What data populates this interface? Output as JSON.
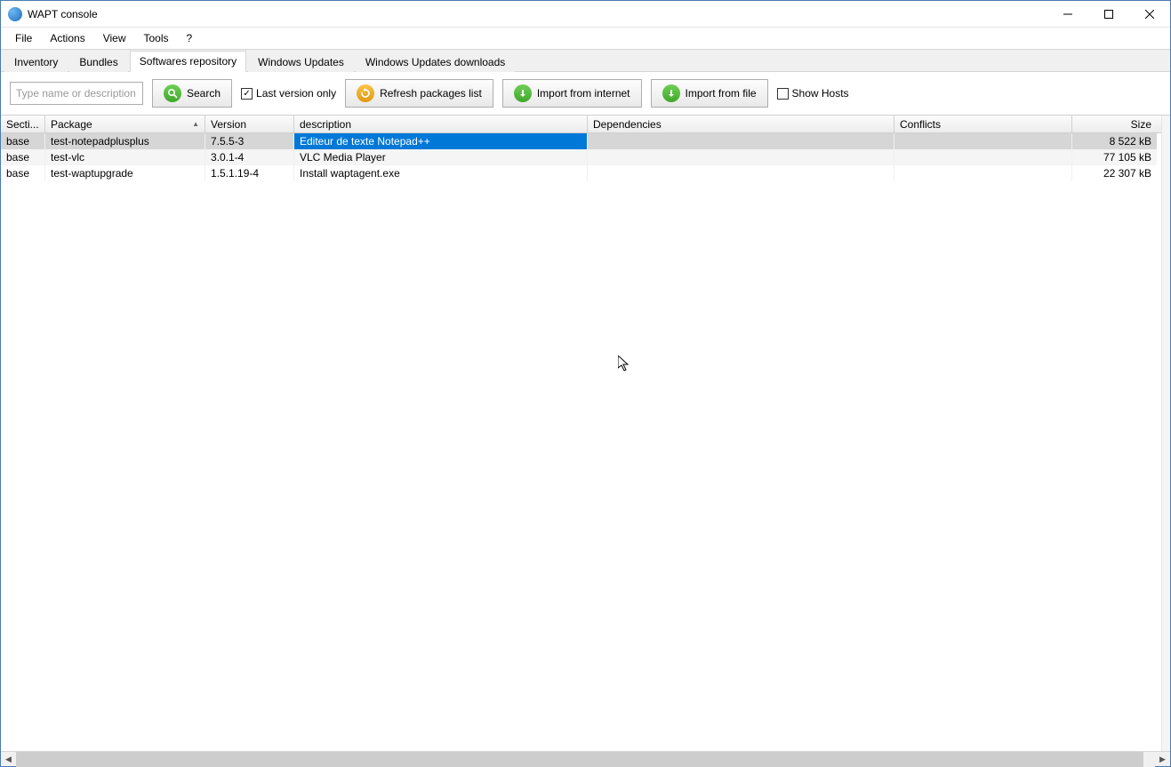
{
  "window": {
    "title": "WAPT console"
  },
  "menu": {
    "items": [
      "File",
      "Actions",
      "View",
      "Tools",
      "?"
    ]
  },
  "tabs": {
    "items": [
      "Inventory",
      "Bundles",
      "Softwares repository",
      "Windows Updates",
      "Windows Updates downloads"
    ],
    "active_index": 2
  },
  "toolbar": {
    "search_placeholder": "Type name or description",
    "search_button": "Search",
    "last_version_only": "Last version only",
    "last_version_only_checked": true,
    "refresh_button": "Refresh packages list",
    "import_internet_button": "Import from internet",
    "import_file_button": "Import from file",
    "show_hosts": "Show Hosts",
    "show_hosts_checked": false
  },
  "grid": {
    "columns": {
      "section": "Secti...",
      "package": "Package",
      "version": "Version",
      "description": "description",
      "dependencies": "Dependencies",
      "conflicts": "Conflicts",
      "size": "Size"
    },
    "rows": [
      {
        "section": "base",
        "package": "test-notepadplusplus",
        "version": "7.5.5-3",
        "description": "Editeur de texte Notepad++",
        "dependencies": "",
        "conflicts": "",
        "size": "8 522 kB",
        "selected": true
      },
      {
        "section": "base",
        "package": "test-vlc",
        "version": "3.0.1-4",
        "description": "VLC Media Player",
        "dependencies": "",
        "conflicts": "",
        "size": "77 105 kB",
        "selected": false
      },
      {
        "section": "base",
        "package": "test-waptupgrade",
        "version": "1.5.1.19-4",
        "description": "Install waptagent.exe",
        "dependencies": "",
        "conflicts": "",
        "size": "22 307 kB",
        "selected": false
      }
    ]
  }
}
